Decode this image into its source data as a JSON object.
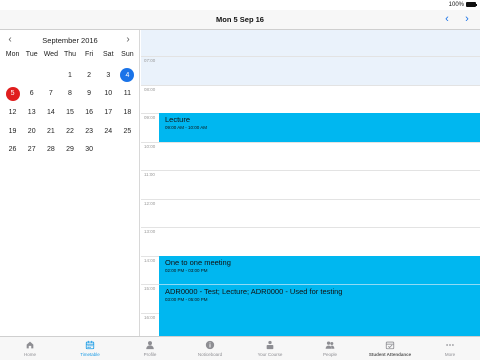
{
  "status_bar": {
    "battery": "100%"
  },
  "nav": {
    "title": "Mon 5 Sep 16",
    "prev_icon": "chevron-left-icon",
    "next_icon": "chevron-right-icon",
    "accent": "#1a73e8"
  },
  "calendar": {
    "month": "September 2016",
    "weekdays": [
      "Mon",
      "Tue",
      "Wed",
      "Thu",
      "Fri",
      "Sat",
      "Sun"
    ],
    "days": [
      "",
      "",
      "",
      "1",
      "2",
      "3",
      "4",
      "5",
      "6",
      "7",
      "8",
      "9",
      "10",
      "11",
      "12",
      "13",
      "14",
      "15",
      "16",
      "17",
      "18",
      "19",
      "20",
      "21",
      "22",
      "23",
      "24",
      "25",
      "26",
      "27",
      "28",
      "29",
      "30",
      "",
      ""
    ],
    "selected_day": "5",
    "today_day": "4",
    "selected_color": "#e01e1e",
    "today_color": "#1a73e8"
  },
  "timeline": {
    "hours": [
      "07:00",
      "08:00",
      "09:00",
      "10:00",
      "11:00",
      "12:00",
      "13:00",
      "14:00",
      "15:00",
      "16:00"
    ],
    "events": [
      {
        "title": "Lecture",
        "time": "09:00 AM - 10:00 AM"
      },
      {
        "title": "One to one meeting",
        "time": "02:00 PM - 03:00 PM"
      },
      {
        "title": "ADR0000 - Test; Lecture; ADR0000 - Used for testing",
        "time": "03:00 PM - 05:00 PM"
      }
    ],
    "event_color": "#00b7f0"
  },
  "tabs": [
    {
      "label": "Home",
      "icon": "home-icon"
    },
    {
      "label": "Timetable",
      "icon": "calendar-icon",
      "active": true
    },
    {
      "label": "Profile",
      "icon": "person-icon"
    },
    {
      "label": "Noticeboard",
      "icon": "info-icon"
    },
    {
      "label": "Your Course",
      "icon": "course-icon"
    },
    {
      "label": "People",
      "icon": "people-icon"
    },
    {
      "label": "Student Attendance",
      "icon": "attendance-icon"
    },
    {
      "label": "More",
      "icon": "more-icon"
    }
  ]
}
